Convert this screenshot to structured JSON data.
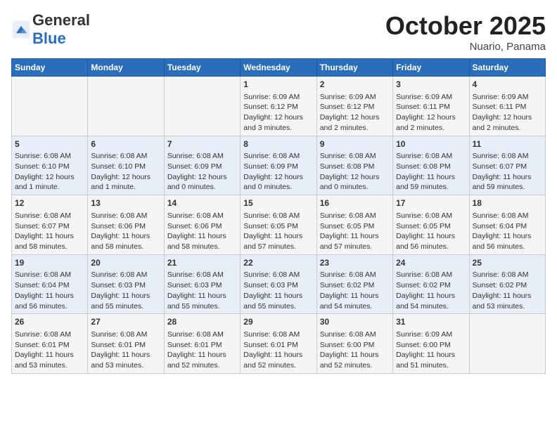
{
  "logo": {
    "general": "General",
    "blue": "Blue"
  },
  "header": {
    "month": "October 2025",
    "location": "Nuario, Panama"
  },
  "weekdays": [
    "Sunday",
    "Monday",
    "Tuesday",
    "Wednesday",
    "Thursday",
    "Friday",
    "Saturday"
  ],
  "weeks": [
    [
      {
        "day": "",
        "info": ""
      },
      {
        "day": "",
        "info": ""
      },
      {
        "day": "",
        "info": ""
      },
      {
        "day": "1",
        "info": "Sunrise: 6:09 AM\nSunset: 6:12 PM\nDaylight: 12 hours and 3 minutes."
      },
      {
        "day": "2",
        "info": "Sunrise: 6:09 AM\nSunset: 6:12 PM\nDaylight: 12 hours and 2 minutes."
      },
      {
        "day": "3",
        "info": "Sunrise: 6:09 AM\nSunset: 6:11 PM\nDaylight: 12 hours and 2 minutes."
      },
      {
        "day": "4",
        "info": "Sunrise: 6:09 AM\nSunset: 6:11 PM\nDaylight: 12 hours and 2 minutes."
      }
    ],
    [
      {
        "day": "5",
        "info": "Sunrise: 6:08 AM\nSunset: 6:10 PM\nDaylight: 12 hours and 1 minute."
      },
      {
        "day": "6",
        "info": "Sunrise: 6:08 AM\nSunset: 6:10 PM\nDaylight: 12 hours and 1 minute."
      },
      {
        "day": "7",
        "info": "Sunrise: 6:08 AM\nSunset: 6:09 PM\nDaylight: 12 hours and 0 minutes."
      },
      {
        "day": "8",
        "info": "Sunrise: 6:08 AM\nSunset: 6:09 PM\nDaylight: 12 hours and 0 minutes."
      },
      {
        "day": "9",
        "info": "Sunrise: 6:08 AM\nSunset: 6:08 PM\nDaylight: 12 hours and 0 minutes."
      },
      {
        "day": "10",
        "info": "Sunrise: 6:08 AM\nSunset: 6:08 PM\nDaylight: 11 hours and 59 minutes."
      },
      {
        "day": "11",
        "info": "Sunrise: 6:08 AM\nSunset: 6:07 PM\nDaylight: 11 hours and 59 minutes."
      }
    ],
    [
      {
        "day": "12",
        "info": "Sunrise: 6:08 AM\nSunset: 6:07 PM\nDaylight: 11 hours and 58 minutes."
      },
      {
        "day": "13",
        "info": "Sunrise: 6:08 AM\nSunset: 6:06 PM\nDaylight: 11 hours and 58 minutes."
      },
      {
        "day": "14",
        "info": "Sunrise: 6:08 AM\nSunset: 6:06 PM\nDaylight: 11 hours and 58 minutes."
      },
      {
        "day": "15",
        "info": "Sunrise: 6:08 AM\nSunset: 6:05 PM\nDaylight: 11 hours and 57 minutes."
      },
      {
        "day": "16",
        "info": "Sunrise: 6:08 AM\nSunset: 6:05 PM\nDaylight: 11 hours and 57 minutes."
      },
      {
        "day": "17",
        "info": "Sunrise: 6:08 AM\nSunset: 6:05 PM\nDaylight: 11 hours and 56 minutes."
      },
      {
        "day": "18",
        "info": "Sunrise: 6:08 AM\nSunset: 6:04 PM\nDaylight: 11 hours and 56 minutes."
      }
    ],
    [
      {
        "day": "19",
        "info": "Sunrise: 6:08 AM\nSunset: 6:04 PM\nDaylight: 11 hours and 56 minutes."
      },
      {
        "day": "20",
        "info": "Sunrise: 6:08 AM\nSunset: 6:03 PM\nDaylight: 11 hours and 55 minutes."
      },
      {
        "day": "21",
        "info": "Sunrise: 6:08 AM\nSunset: 6:03 PM\nDaylight: 11 hours and 55 minutes."
      },
      {
        "day": "22",
        "info": "Sunrise: 6:08 AM\nSunset: 6:03 PM\nDaylight: 11 hours and 55 minutes."
      },
      {
        "day": "23",
        "info": "Sunrise: 6:08 AM\nSunset: 6:02 PM\nDaylight: 11 hours and 54 minutes."
      },
      {
        "day": "24",
        "info": "Sunrise: 6:08 AM\nSunset: 6:02 PM\nDaylight: 11 hours and 54 minutes."
      },
      {
        "day": "25",
        "info": "Sunrise: 6:08 AM\nSunset: 6:02 PM\nDaylight: 11 hours and 53 minutes."
      }
    ],
    [
      {
        "day": "26",
        "info": "Sunrise: 6:08 AM\nSunset: 6:01 PM\nDaylight: 11 hours and 53 minutes."
      },
      {
        "day": "27",
        "info": "Sunrise: 6:08 AM\nSunset: 6:01 PM\nDaylight: 11 hours and 53 minutes."
      },
      {
        "day": "28",
        "info": "Sunrise: 6:08 AM\nSunset: 6:01 PM\nDaylight: 11 hours and 52 minutes."
      },
      {
        "day": "29",
        "info": "Sunrise: 6:08 AM\nSunset: 6:01 PM\nDaylight: 11 hours and 52 minutes."
      },
      {
        "day": "30",
        "info": "Sunrise: 6:08 AM\nSunset: 6:00 PM\nDaylight: 11 hours and 52 minutes."
      },
      {
        "day": "31",
        "info": "Sunrise: 6:09 AM\nSunset: 6:00 PM\nDaylight: 11 hours and 51 minutes."
      },
      {
        "day": "",
        "info": ""
      }
    ]
  ]
}
